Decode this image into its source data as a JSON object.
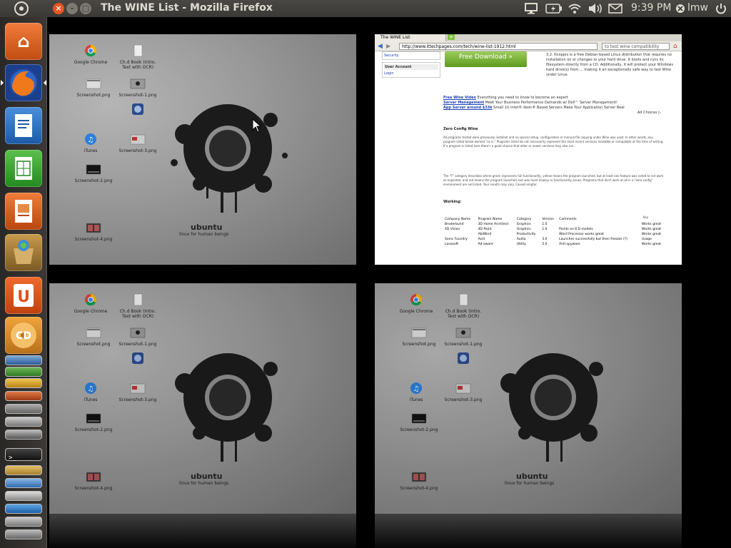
{
  "panel": {
    "window_title": "The WINE List - Mozilla Firefox",
    "clock": "9:39 PM",
    "user": "lmw",
    "indicators": [
      "display-icon",
      "battery-icon",
      "wifi-icon",
      "volume-icon",
      "mail-icon"
    ]
  },
  "launcher": {
    "items": [
      {
        "name": "home-folder",
        "glyph": "⌂",
        "color": "#e2631d"
      },
      {
        "name": "firefox",
        "glyph": "◉",
        "color": "#2a63b8"
      },
      {
        "name": "writer",
        "glyph": "≣",
        "color": "#2b77c9"
      },
      {
        "name": "calc",
        "glyph": "▦",
        "color": "#3aa33a"
      },
      {
        "name": "impress",
        "glyph": "▣",
        "color": "#d45a17"
      },
      {
        "name": "software-center",
        "glyph": "◈",
        "color": "#b8872f"
      },
      {
        "name": "ubuntu-one",
        "glyph": "U",
        "color": "#e0521c"
      },
      {
        "name": "cd",
        "glyph": "CD",
        "color": "#d98c2a"
      }
    ]
  },
  "desktop_icons": {
    "chrome": "Google Chrome",
    "text_file": "Ch.d Book (Intro. Text with OCR)",
    "shot1": "Screenshot.png",
    "shot2": "Screenshot-1.png",
    "shot3": "Screenshot-2.png",
    "shot4": "Screenshot-3.png",
    "shot5": "Screenshot-4.png",
    "itunes": "iTunes",
    "wine": "wine-icon"
  },
  "wallpaper": {
    "brand": "ubuntu",
    "tagline": "linux for human beings"
  },
  "firefox": {
    "tab_title": "The WINE List",
    "url": "http://www.ittechpages.com/tech/wine-list-1912.html",
    "search": "to test wine compatibility",
    "sidebar_security": "Security",
    "sidebar_user_heading": "User Account",
    "sidebar_login": "Login",
    "download_btn": "Free Download »",
    "top_text": "3.2. Knoppix is a free Debian-based Linux distribution that requires no installation on or changes to your hard drive. It boots and runs its filesystem directly from a CD. Additionally, it will protect your Windows hard drive(s) from ... making it an exceptionally safe way to test Wine under Linux.",
    "ad1_link": "Free Wine Video",
    "ad1_text": "Everything you need to know to become an expert",
    "ad2_link": "Server Management",
    "ad2_text": "Meet Your Business Performance Demands w/ Dell™ Server Management!",
    "ad3_link": "App Server around $33k",
    "ad3_text": "Small 1U Intel® Xeon® Based Servers Make Your Application Server Real",
    "ads_by": "Ad Choices ▷",
    "section_heading": "Zero Config Wine",
    "para1": "All programs tested were previously installed and no special setup, configuration or manual file copying under Wine was used. In other words, any program listed below worked \"as is.\" Programs listed do not necessarily represent the most recent versions available or compatible at the time of writing. If a program is listed here there's a good chance that older or newer versions may also run.",
    "para2": "The \"F\" category describes where green represents full functionality, yellow means the program launched, but at least one feature was noted to not work as expected, and red means the program launched, but was more display or functionality issues. Programs that don't work at all in a \"zero config\" environment are not listed. Your results may vary. Caveat emptor.",
    "working_heading": "Working:",
    "key_label": "Key",
    "columns": [
      "Company Name",
      "Program Name",
      "Category",
      "Version",
      "Comments"
    ],
    "rows": [
      [
        "Broderbund",
        "3D Home Architect",
        "Graphics",
        "1.0",
        "",
        "Works great"
      ],
      [
        "4D Vision",
        "4D Paint",
        "Graphics",
        "1.0",
        "Points on 8 D models",
        "Works great"
      ],
      [
        "",
        "AbiWord",
        "Productivity",
        "",
        "Word Processor works great",
        "Works great"
      ],
      [
        "Sonic Foundry",
        "Acid",
        "Audio",
        "3.0",
        "Launches successfully but then freezes (?)",
        "Usage"
      ],
      [
        "Lavasoft",
        "Ad-aware",
        "Utility",
        "5.0",
        "Anti-spyware",
        "Works great"
      ]
    ]
  }
}
